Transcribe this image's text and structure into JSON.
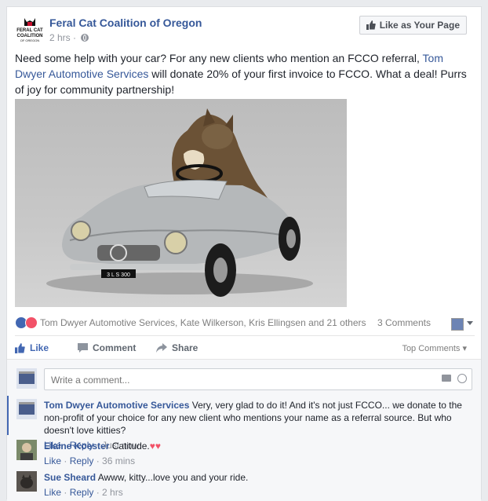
{
  "post": {
    "page_name": "Feral Cat Coalition of Oregon",
    "time": "2 hrs",
    "separator": "·",
    "like_page_label": "Like as Your Page",
    "logo_text": [
      "FERAL CAT",
      "COALITION",
      "OF OREGON"
    ],
    "text_before": "Need some help with your car? For any new clients who mention an FCCO referral, ",
    "link_text": "Tom Dwyer Automotive Services",
    "text_after": " will donate 20% of your first invoice to FCCO. What a deal! Purrs of joy for community partnership!",
    "photo_plate": "3 L S 300"
  },
  "reactions": {
    "names": "Tom Dwyer Automotive Services, Kate Wilkerson, Kris Ellingsen and 21 others",
    "comments_count": "3 Comments",
    "like_color": "#4267b2",
    "love_color": "#f25268"
  },
  "actions": {
    "like": "Like",
    "comment": "Comment",
    "share": "Share",
    "top_comments": "Top Comments"
  },
  "composer": {
    "placeholder": "Write a comment..."
  },
  "comments": [
    {
      "author": "Tom Dwyer Automotive Services",
      "text": "Very, very glad to do it! And it's not just FCCO... we donate to the non-profit of your choice for any new client who mentions your name as a referral source. But who doesn't love kitties?",
      "like": "Like",
      "reply": "Reply",
      "time": "Just now"
    },
    {
      "author": "Elaine Koester",
      "text": "Catitude.",
      "like": "Like",
      "reply": "Reply",
      "time": "36 mins"
    },
    {
      "author": "Sue Sheard",
      "text": "Awww, kitty...love you and your ride.",
      "like": "Like",
      "reply": "Reply",
      "time": "2 hrs"
    }
  ]
}
